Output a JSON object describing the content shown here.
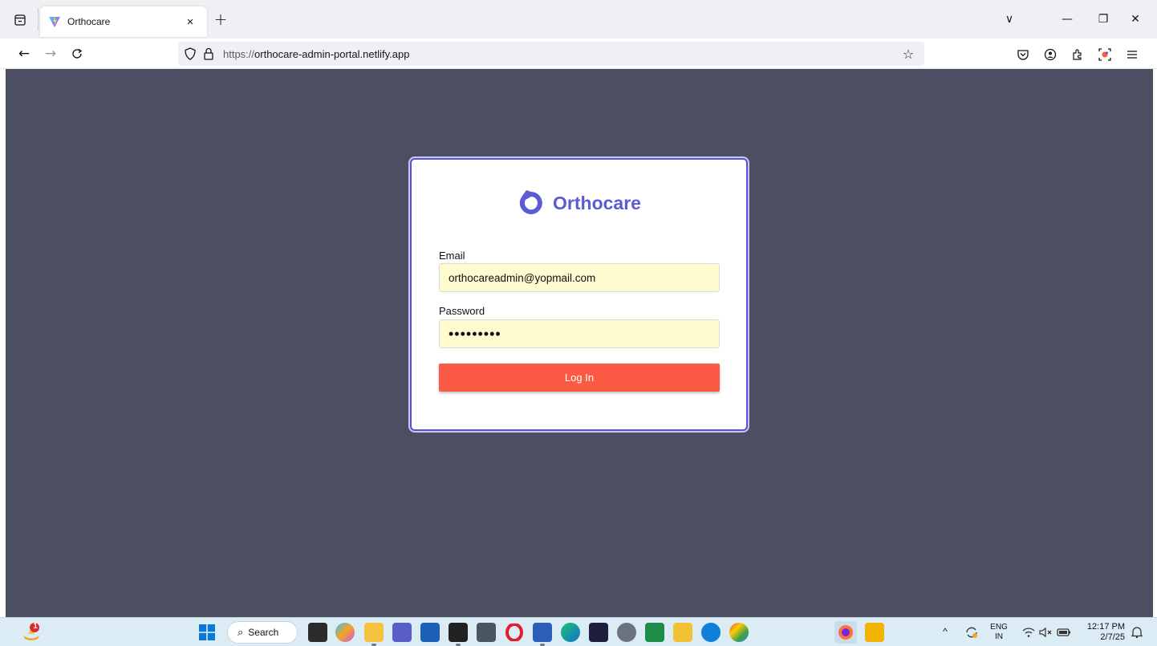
{
  "browser": {
    "tab": {
      "title": "Orthocare",
      "close_glyph": "×"
    },
    "new_tab_glyph": "+",
    "window_controls": {
      "list_all_tabs": "∨",
      "minimize": "—",
      "restore": "❐",
      "close": "✕"
    },
    "nav": {
      "back": "←",
      "forward": "→",
      "reload": "C"
    },
    "url": {
      "scheme": "https://",
      "host": "orthocare-admin-portal.netlify.app"
    },
    "bookmark_glyph": "☆"
  },
  "login": {
    "brand_name": "Orthocare",
    "email_label": "Email",
    "email_value": "orthocareadmin@yopmail.com",
    "password_label": "Password",
    "password_value": "•••••••••",
    "button_label": "Log In"
  },
  "taskbar": {
    "notification_count": "1",
    "search_label": "Search",
    "search_glyph": "⌕",
    "tray_caret": "^",
    "language_top": "ENG",
    "language_bottom": "IN",
    "time": "12:17 PM",
    "date": "2/7/25"
  },
  "colors": {
    "page_background": "#4c4e62",
    "brand_accent": "#5b5bd6",
    "login_button": "#fb5a44",
    "autofill_field": "#fffbd0"
  }
}
